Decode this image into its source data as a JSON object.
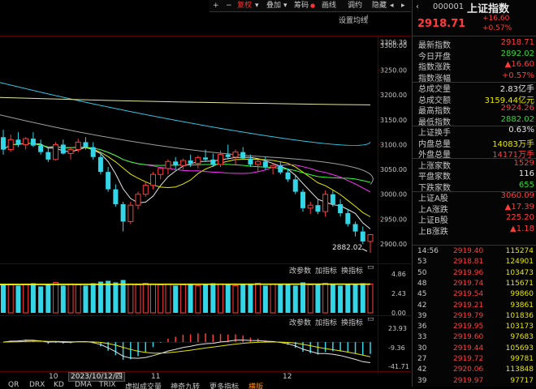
{
  "toolbar": {
    "plus": "+",
    "minus": "−",
    "fuquan": "复权",
    "diejia": "叠加",
    "choumai": "筹码",
    "huaxian": "画线",
    "duanqi": "调约",
    "yincang": "隐藏",
    "prev": "◂",
    "next": "▸"
  },
  "main_chart": {
    "ma_setting": "设置均线",
    "low_label": "2882.02",
    "price_ticks": [
      "3306.39",
      "3300.00",
      "3250.00",
      "3200.00",
      "3150.00",
      "3100.00",
      "3050.00",
      "3000.00",
      "2950.00",
      "2900.00"
    ],
    "price_range": [
      2882,
      3306.39
    ],
    "candles": [
      [
        3115,
        3130,
        3080,
        3090
      ],
      [
        3090,
        3120,
        3085,
        3110
      ],
      [
        3110,
        3125,
        3095,
        3100
      ],
      [
        3100,
        3115,
        3090,
        3112
      ],
      [
        3112,
        3125,
        3095,
        3098
      ],
      [
        3098,
        3110,
        3080,
        3085
      ],
      [
        3085,
        3095,
        3065,
        3070
      ],
      [
        3070,
        3105,
        3068,
        3100
      ],
      [
        3100,
        3110,
        3080,
        3082
      ],
      [
        3082,
        3095,
        3070,
        3090
      ],
      [
        3090,
        3112,
        3085,
        3105
      ],
      [
        3105,
        3115,
        3090,
        3095
      ],
      [
        3095,
        3105,
        3070,
        3075
      ],
      [
        3075,
        3085,
        3040,
        3045
      ],
      [
        3045,
        3055,
        3005,
        3010
      ],
      [
        3010,
        3020,
        2975,
        2980
      ],
      [
        2980,
        2985,
        2925,
        2945
      ],
      [
        2945,
        2985,
        2940,
        2978
      ],
      [
        2978,
        3005,
        2970,
        3000
      ],
      [
        3000,
        3025,
        2995,
        3018
      ],
      [
        3018,
        3045,
        3010,
        3040
      ],
      [
        3040,
        3055,
        3030,
        3052
      ],
      [
        3052,
        3070,
        3040,
        3066
      ],
      [
        3066,
        3075,
        3050,
        3058
      ],
      [
        3058,
        3072,
        3050,
        3068
      ],
      [
        3068,
        3080,
        3055,
        3062
      ],
      [
        3062,
        3078,
        3052,
        3074
      ],
      [
        3074,
        3090,
        3065,
        3070
      ],
      [
        3070,
        3082,
        3055,
        3060
      ],
      [
        3060,
        3088,
        3055,
        3080
      ],
      [
        3080,
        3100,
        3070,
        3075
      ],
      [
        3075,
        3090,
        3060,
        3085
      ],
      [
        3085,
        3095,
        3070,
        3072
      ],
      [
        3072,
        3080,
        3055,
        3060
      ],
      [
        3060,
        3070,
        3045,
        3066
      ],
      [
        3066,
        3075,
        3050,
        3054
      ],
      [
        3054,
        3062,
        3040,
        3058
      ],
      [
        3058,
        3066,
        3040,
        3044
      ],
      [
        3044,
        3052,
        3025,
        3030
      ],
      [
        3030,
        3038,
        3000,
        3005
      ],
      [
        3005,
        3010,
        2965,
        2972
      ],
      [
        2972,
        2985,
        2960,
        2978
      ],
      [
        2978,
        2990,
        2960,
        2965
      ],
      [
        2965,
        3008,
        2955,
        3000
      ],
      [
        3000,
        3008,
        2975,
        2980
      ],
      [
        2980,
        2990,
        2955,
        2962
      ],
      [
        2962,
        2970,
        2935,
        2940
      ],
      [
        2940,
        2945,
        2915,
        2925
      ],
      [
        2925,
        2935,
        2900,
        2905
      ],
      [
        2905,
        2920,
        2882.02,
        2918.71
      ]
    ]
  },
  "volume_panel": {
    "btn_gai": "改参数",
    "btn_jia": "加指标",
    "btn_huan": "换指标",
    "ticks": [
      "4.86",
      "2.43",
      "0.00"
    ],
    "bars": [
      3.6,
      3.5,
      3.4,
      3.6,
      3.7,
      3.3,
      3.5,
      3.8,
      3.4,
      3.6,
      3.5,
      3.4,
      3.7,
      3.9,
      4.0,
      3.8,
      4.1,
      3.6,
      3.5,
      3.7,
      3.6,
      3.5,
      3.6,
      3.4,
      3.5,
      3.6,
      3.4,
      3.5,
      3.7,
      3.6,
      3.5,
      3.4,
      3.6,
      3.5,
      3.7,
      3.4,
      3.6,
      3.5,
      3.6,
      3.4,
      3.8,
      3.5,
      3.6,
      3.7,
      3.5,
      3.4,
      3.6,
      3.5,
      3.7,
      3.6
    ]
  },
  "macd_panel": {
    "btn_gai": "改参数",
    "btn_jia": "加指标",
    "btn_huan": "换指标",
    "ticks": [
      "23.93",
      "-9.36",
      "-41.71"
    ]
  },
  "xaxis": {
    "labels": [
      "10",
      "2023/10/12/四",
      "11",
      "12"
    ]
  },
  "bottom_tabs": [
    "QR",
    "DRX",
    "KD",
    "DMA",
    "TRIX",
    "虚拟成交量",
    "神奇九转",
    "更多指标",
    "横版"
  ],
  "quote": {
    "code": "000001",
    "name": "上证指数",
    "price": "2918.71",
    "change": "+16.60",
    "change_pct": "+0.57%",
    "rows": [
      {
        "label": "最新指数",
        "value": "2918.71",
        "color": "red"
      },
      {
        "label": "今日开盘",
        "value": "2892.02",
        "color": "green"
      },
      {
        "label": "指数涨跌",
        "value": "▲16.60",
        "color": "red"
      },
      {
        "label": "指数涨幅",
        "value": "+0.57%",
        "color": "red"
      },
      {
        "label": "总成交量",
        "value": "2.83亿手",
        "color": "white"
      },
      {
        "label": "总成交额",
        "value": "3159.44亿元",
        "color": "yellow"
      },
      {
        "label": "最高指数",
        "value": "2924.26",
        "color": "red"
      },
      {
        "label": "最低指数",
        "value": "2882.02",
        "color": "green"
      },
      {
        "label": "上证换手",
        "value": "0.63%",
        "color": "white"
      },
      {
        "label": "内盘总量",
        "value": "14083万手",
        "color": "yellow"
      },
      {
        "label": "外盘总量",
        "value": "14171万手",
        "color": "red"
      },
      {
        "label": "上涨家数",
        "value": "1529",
        "color": "red"
      },
      {
        "label": "平盘家数",
        "value": "116",
        "color": "white"
      },
      {
        "label": "下跌家数",
        "value": "655",
        "color": "green"
      },
      {
        "label": "上证A股",
        "value": "3060.09",
        "color": "red"
      },
      {
        "label": "上A涨跌",
        "value": "▲17.39",
        "color": "red"
      },
      {
        "label": "上证B股",
        "value": "225.20",
        "color": "red"
      },
      {
        "label": "上B涨跌",
        "value": "▲1.18",
        "color": "red"
      }
    ],
    "ticks": [
      {
        "time": "14:56",
        "price": "2919.40",
        "vol": "115274"
      },
      {
        "time": "53",
        "price": "2918.81",
        "vol": "124901"
      },
      {
        "time": "50",
        "price": "2919.96",
        "vol": "103473"
      },
      {
        "time": "48",
        "price": "2919.74",
        "vol": "115671"
      },
      {
        "time": "45",
        "price": "2919.54",
        "vol": "99860"
      },
      {
        "time": "42",
        "price": "2919.21",
        "vol": "93861"
      },
      {
        "time": "39",
        "price": "2919.79",
        "vol": "101836"
      },
      {
        "time": "36",
        "price": "2919.95",
        "vol": "103173"
      },
      {
        "time": "33",
        "price": "2919.60",
        "vol": "97683"
      },
      {
        "time": "30",
        "price": "2919.44",
        "vol": "105693"
      },
      {
        "time": "27",
        "price": "2919.72",
        "vol": "99781"
      },
      {
        "time": "42",
        "price": "2920.06",
        "vol": "113848"
      },
      {
        "time": "39",
        "price": "2919.97",
        "vol": "97717"
      }
    ]
  },
  "colors": {
    "up": "#ff3c3c",
    "down": "#33d6e6",
    "ma5": "#e6e6e6",
    "ma10": "#e6e600",
    "ma20": "#ff33ff",
    "ma30": "#33ff33",
    "ma60": "#a0a0a0",
    "ma120": "#33c8e6",
    "ma250": "#e6e6a0"
  }
}
